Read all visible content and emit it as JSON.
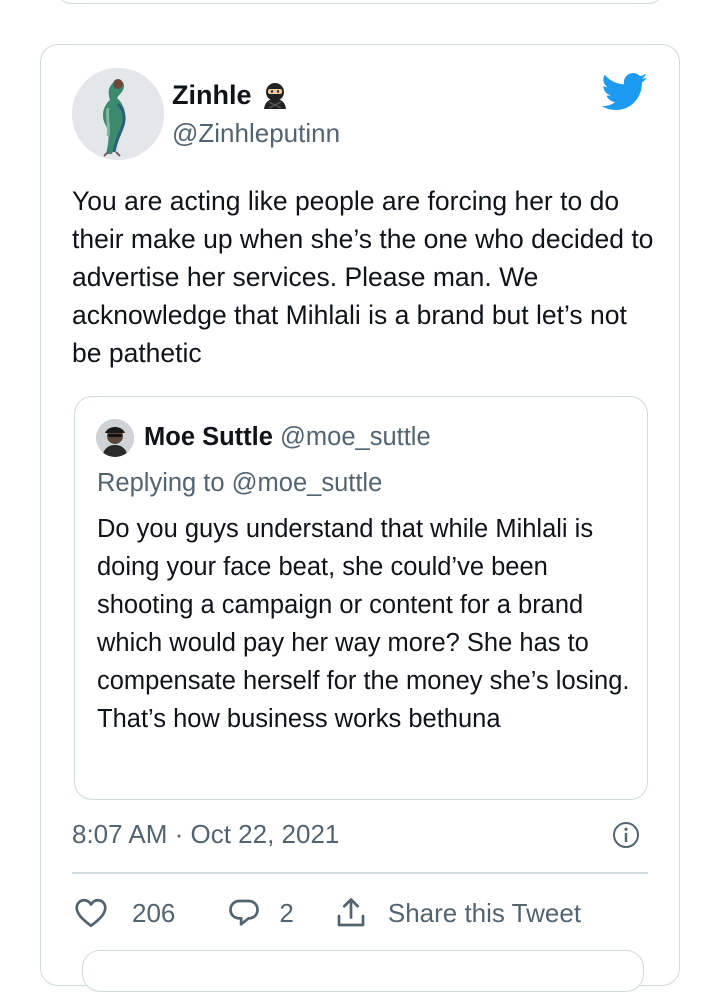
{
  "colors": {
    "twitter_blue": "#1d9bf0",
    "text_primary": "#0f1419",
    "text_secondary": "#536471",
    "border": "#cfd9de"
  },
  "tweet": {
    "author": {
      "name": "Zinhle",
      "name_emoji": "ninja",
      "handle": "@Zinhleputinn",
      "avatar": "avatar-photo"
    },
    "text": "You are acting like people are forcing her to do their make up when she’s the one who decided to advertise her services. Please man. We acknowledge that Mihlali is a brand but let’s not be pathetic",
    "quoted": {
      "name": "Moe Suttle",
      "handle": "@moe_suttle",
      "replying_to": "Replying to @moe_suttle",
      "text": "Do you guys understand that while Mihlali is doing your face beat, she could’ve been shooting a campaign or content for a brand which would pay her way more? She has to compensate herself for the money she’s losing. That’s how business works bethuna"
    },
    "timestamp": "8:07 AM · Oct 22, 2021",
    "likes": "206",
    "replies": "2",
    "share_label": "Share this Tweet"
  },
  "icons": {
    "brand": "twitter-bird-icon",
    "info": "info-icon",
    "like": "heart-icon",
    "reply": "reply-bubble-icon",
    "share": "share-icon"
  }
}
